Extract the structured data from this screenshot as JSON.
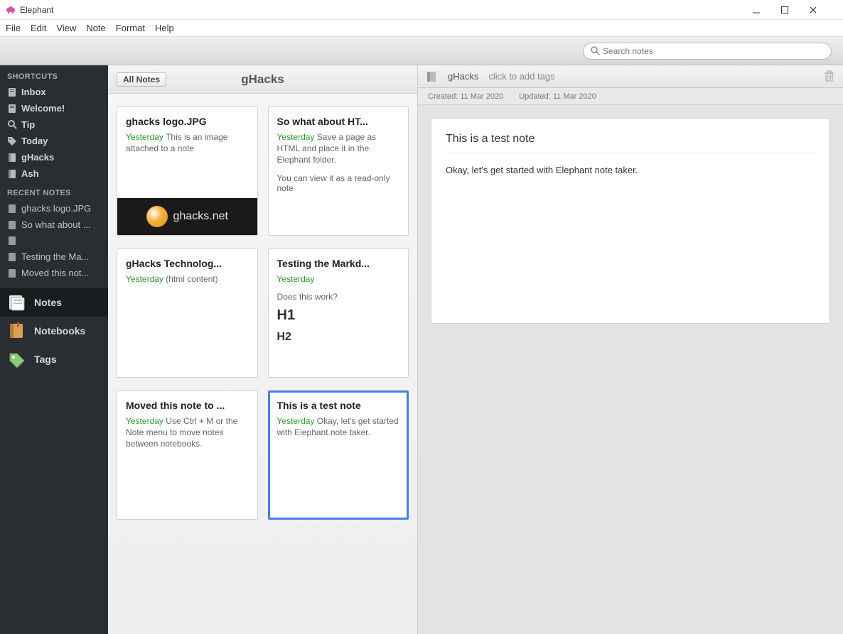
{
  "window": {
    "app_name": "Elephant"
  },
  "menu": [
    "File",
    "Edit",
    "View",
    "Note",
    "Format",
    "Help"
  ],
  "search": {
    "placeholder": "Search notes"
  },
  "sidebar": {
    "shortcuts_hdr": "SHORTCUTS",
    "shortcuts": [
      {
        "label": "Inbox",
        "icon": "note"
      },
      {
        "label": "Welcome!",
        "icon": "note"
      },
      {
        "label": "Tip",
        "icon": "search"
      },
      {
        "label": "Today",
        "icon": "tag"
      },
      {
        "label": "gHacks",
        "icon": "notebook"
      },
      {
        "label": "Ash",
        "icon": "notebook"
      }
    ],
    "recent_hdr": "RECENT NOTES",
    "recent": [
      "ghacks logo.JPG",
      "So what about ...",
      "",
      "Testing the Ma...",
      "Moved this not..."
    ],
    "nav": [
      {
        "label": "Notes",
        "active": true
      },
      {
        "label": "Notebooks",
        "active": false
      },
      {
        "label": "Tags",
        "active": false
      }
    ]
  },
  "list": {
    "all_notes_btn": "All Notes",
    "notebook_title": "gHacks",
    "cards": [
      {
        "title": "ghacks logo.JPG",
        "date": "Yesterday",
        "excerpt": "This is an image attached to a note",
        "thumb": true,
        "thumb_text": "ghacks.net"
      },
      {
        "title": "So what about HT...",
        "date": "Yesterday",
        "excerpt": "Save a page as HTML and place it in the Elephant folder.",
        "extra": "You can view it as a read-only note"
      },
      {
        "title": "gHacks Technolog...",
        "date": "Yesterday",
        "excerpt": "(html content)"
      },
      {
        "title": "Testing the Markd...",
        "date": "Yesterday",
        "excerpt": "",
        "extra": "Does this work?",
        "h1": "H1",
        "h2": "H2"
      },
      {
        "title": "Moved this note to ...",
        "date": "Yesterday",
        "excerpt": "Use Ctrl + M or the Note menu to move notes between notebooks."
      },
      {
        "title": "This is a test note",
        "date": "Yesterday",
        "excerpt": "Okay, let's get started with Elephant note taker.",
        "selected": true
      }
    ]
  },
  "detail": {
    "notebook_name": "gHacks",
    "tags_prompt": "click to add tags",
    "created_label": "Created: 11 Mar 2020",
    "updated_label": "Updated: 11 Mar 2020",
    "note_title": "This is a test note",
    "note_body": "Okay, let's get started with Elephant note taker."
  }
}
